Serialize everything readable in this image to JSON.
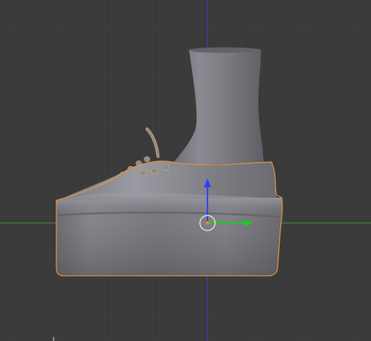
{
  "viewport": {
    "view": "Right Ortho",
    "background_color": "#3a3a3a",
    "grid_minor_color": "#404040",
    "grid_major_color": "#353535",
    "axis_y_color": "#3f8a3f",
    "axis_z_color": "#3a3ad0"
  },
  "object": {
    "name": "shoe-mesh",
    "selected": true,
    "selection_outline_color": "#e8953a",
    "origin_color": "#ff8a00"
  },
  "gizmo": {
    "mode": "translate",
    "up_axis_color": "#2a40ff",
    "right_axis_color": "#18d018",
    "center_ring_color": "#e6e6e6"
  }
}
